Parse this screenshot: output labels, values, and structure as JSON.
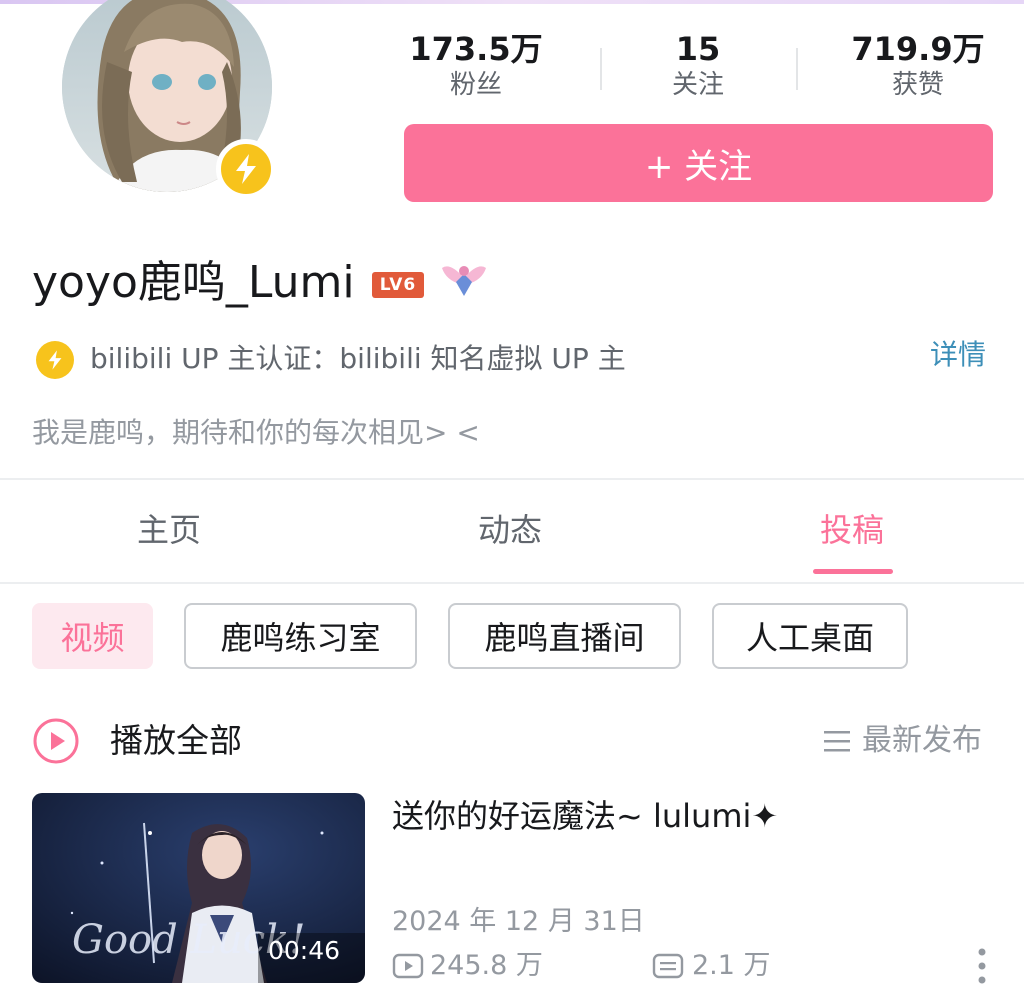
{
  "profile": {
    "stats": [
      {
        "value": "173.5万",
        "label": "粉丝"
      },
      {
        "value": "15",
        "label": "关注"
      },
      {
        "value": "719.9万",
        "label": "获赞"
      }
    ],
    "follow_label": "+ 关注",
    "name": "yoyo鹿鸣_Lumi",
    "level": "LV6",
    "verification": "bilibili UP 主认证：bilibili 知名虚拟 UP 主",
    "detail_link": "详情",
    "bio": "我是鹿鸣，期待和你的每次相见> <"
  },
  "tabs": [
    "主页",
    "动态",
    "投稿"
  ],
  "active_tab": "投稿",
  "filters": [
    "视频",
    "鹿鸣练习室",
    "鹿鸣直播间",
    "人工桌面"
  ],
  "play_all": "播放全部",
  "sort_label": "最新发布",
  "video": {
    "title": "送你的好运魔法~ lulumi✦",
    "date": "2024 年 12 月 31日",
    "views": "245.8 万",
    "comments": "2.1 万",
    "duration": "00:46",
    "thumbnail_overlay": "Good Luck!"
  },
  "colors": {
    "accent": "#fb7299",
    "link": "#3d8fb8",
    "badge": "#f7c31c"
  }
}
